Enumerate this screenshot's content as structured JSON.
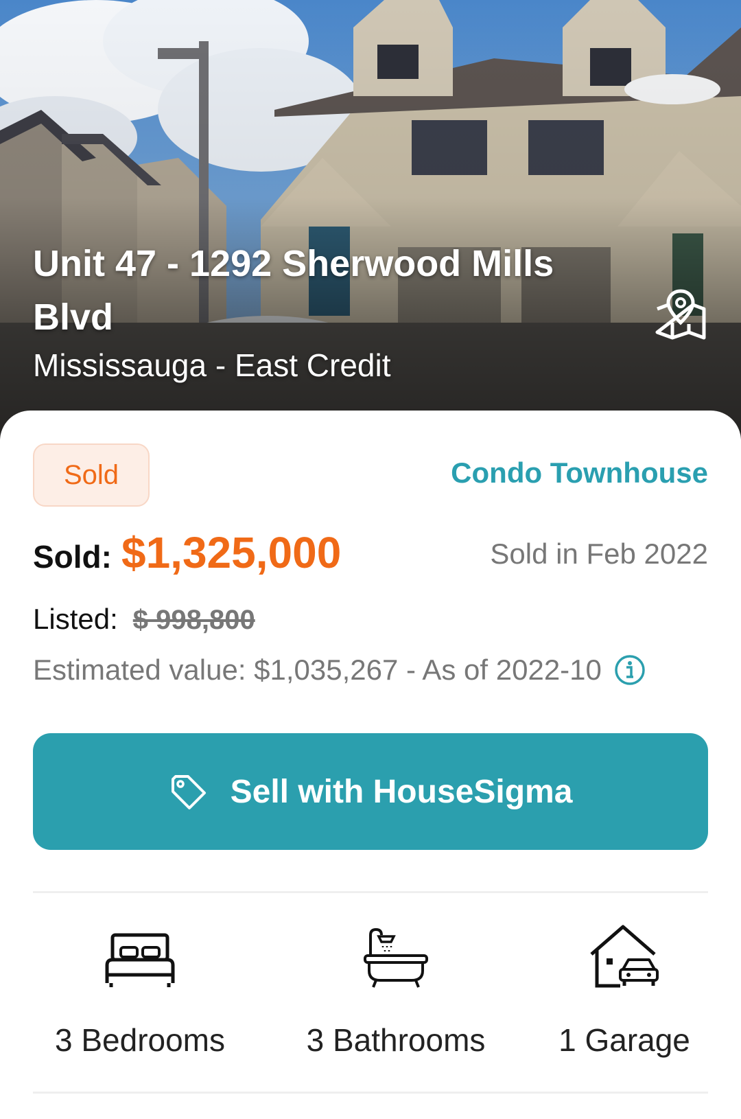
{
  "hero": {
    "title": "Unit 47 - 1292 Sherwood Mills Blvd",
    "subtitle": "Mississauga - East Credit",
    "map_icon": "map-pin-icon"
  },
  "listing": {
    "status": "Sold",
    "property_type": "Condo Townhouse",
    "sold_label": "Sold:",
    "sold_price": "$1,325,000",
    "sold_date": "Sold in Feb 2022",
    "listed_label": "Listed:",
    "listed_price": "$ 998,800",
    "estimate": "Estimated value: $1,035,267 - As of 2022-10",
    "info_icon": "info-icon"
  },
  "sell_button": {
    "label": "Sell with HouseSigma",
    "icon": "tag-icon"
  },
  "features": [
    {
      "label": "3 Bedrooms",
      "icon": "bed-icon"
    },
    {
      "label": "3 Bathrooms",
      "icon": "bathtub-icon"
    },
    {
      "label": "1 Garage",
      "icon": "garage-icon"
    }
  ],
  "colors": {
    "accent_teal": "#2b9fae",
    "sold_orange": "#f06a17",
    "muted_gray": "#777777"
  }
}
